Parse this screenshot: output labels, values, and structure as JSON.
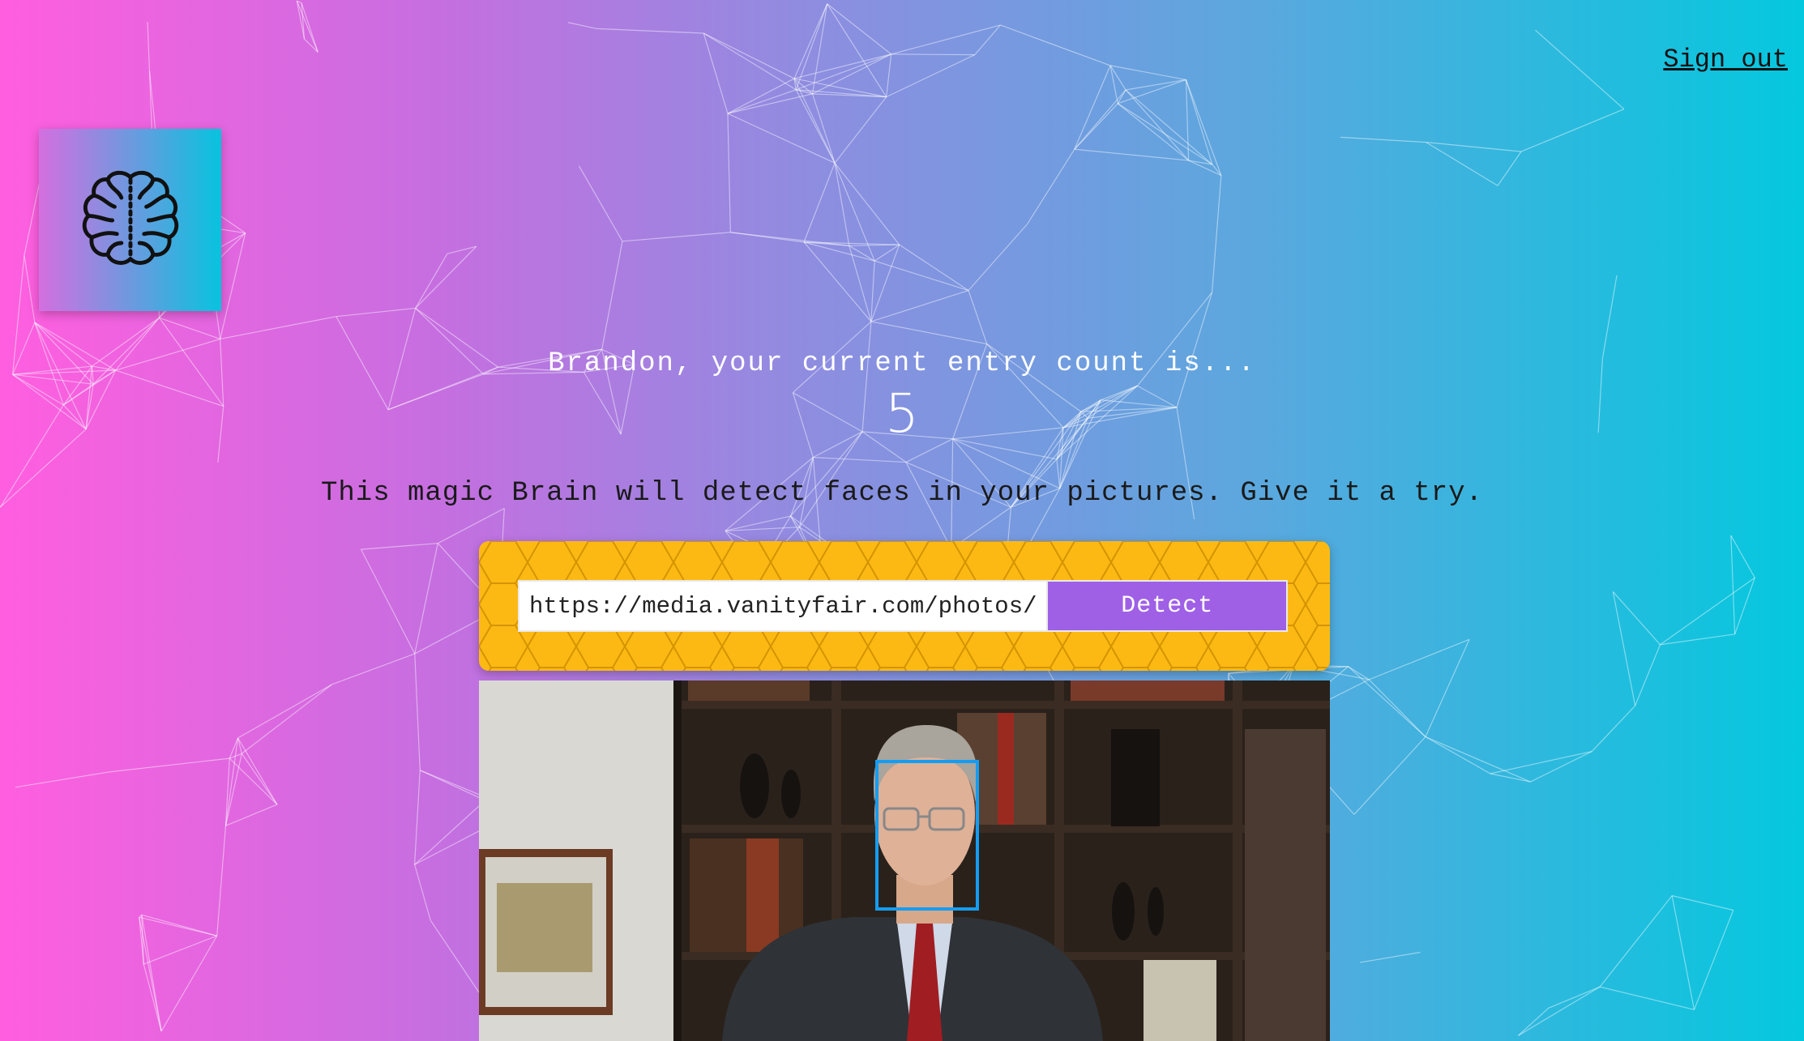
{
  "nav": {
    "sign_out_label": "Sign out"
  },
  "logo": {
    "icon": "brain-icon"
  },
  "rank": {
    "message": "Brandon, your current entry count is...",
    "count": "5"
  },
  "tagline": "This magic Brain will detect faces in your pictures. Give it a try.",
  "form": {
    "url_value": "https://media.vanityfair.com/photos/",
    "detect_label": "Detect"
  },
  "colors": {
    "gradient_left": "#ff5edf",
    "gradient_right": "#04c8de",
    "panel_yellow": "#fdb913",
    "detect_purple": "#9f60e6",
    "face_box_blue": "#149df2"
  }
}
